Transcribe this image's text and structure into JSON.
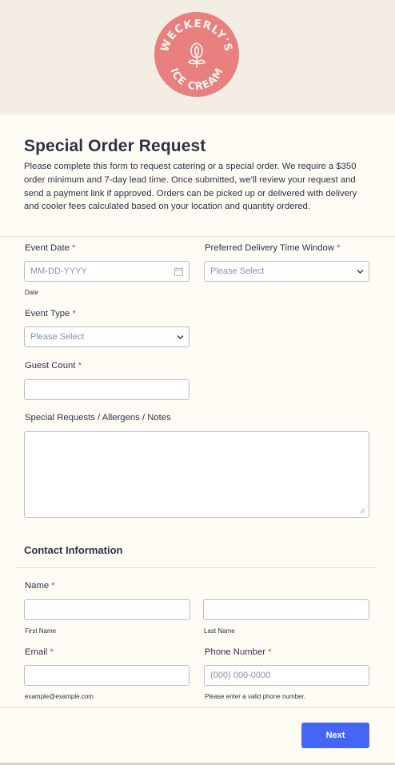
{
  "brand": {
    "logo_text_top": "WECKERLY'S",
    "logo_text_bottom": "ICE CREAM",
    "logo_color": "#e88080"
  },
  "form": {
    "title": "Special Order Request",
    "intro": "Please complete this form to request catering or a special order. We require a $350 order minimum and 7-day lead time. Once submitted, we'll review your request and send a payment link if approved. Orders can be picked up or delivered with delivery and cooler fees calculated based on your location and quantity ordered.",
    "required_mark": "*",
    "event_date": {
      "label": "Event Date",
      "placeholder": "MM-DD-YYYY",
      "sublabel": "Date",
      "icon": "calendar-icon"
    },
    "delivery_window": {
      "label": "Preferred Delivery Time Window",
      "value": "Please Select"
    },
    "event_type": {
      "label": "Event Type",
      "value": "Please Select"
    },
    "guest_count": {
      "label": "Guest Count",
      "value": ""
    },
    "notes": {
      "label": "Special Requests / Allergens / Notes",
      "value": ""
    },
    "contact_section": "Contact Information",
    "name": {
      "label": "Name",
      "first_sublabel": "First Name",
      "last_sublabel": "Last Name"
    },
    "email": {
      "label": "Email",
      "sublabel": "example@example.com"
    },
    "phone": {
      "label": "Phone Number",
      "placeholder": "(000) 000-0000",
      "sublabel": "Please enter a valid phone number."
    },
    "next_label": "Next",
    "accent_color": "#4566f5"
  }
}
